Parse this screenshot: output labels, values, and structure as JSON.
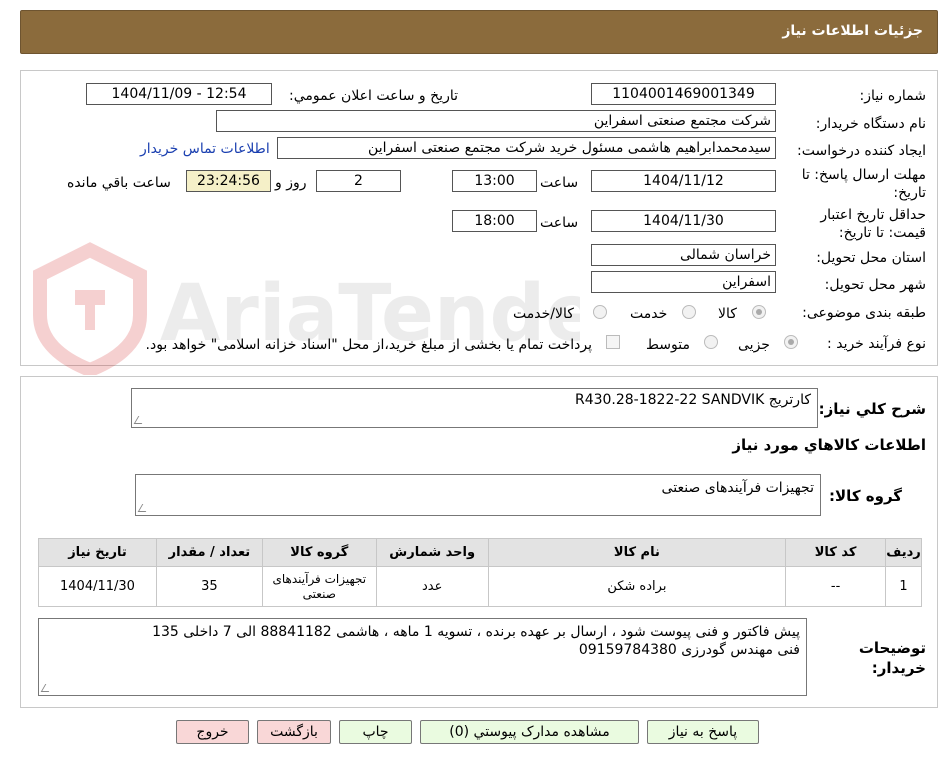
{
  "header": {
    "title": "جزئیات اطلاعات نیاز"
  },
  "form": {
    "need_number_label": "شماره نیاز:",
    "need_number": "1104001469001349",
    "announce_label": "تاریخ و ساعت اعلان عمومي:",
    "announce_value": "1404/11/09 - 12:54",
    "buyer_org_label": "نام دستگاه خريدار:",
    "buyer_org": "شرکت مجتمع صنعتی اسفراین",
    "creator_label": "ايجاد کننده درخواست:",
    "creator": "سیدمحمدابراهیم هاشمی مسئول خرید شرکت مجتمع صنعتی اسفراین",
    "contact_link": "اطلاعات تماس خریدار",
    "deadline_label": "مهلت ارسال پاسخ: تا تاریخ:",
    "deadline_date": "1404/11/12",
    "time_label": "ساعت",
    "deadline_time": "13:00",
    "days": "2",
    "days_label": "روز و",
    "remaining": "23:24:56",
    "remaining_label": "ساعت باقي مانده",
    "validity_label": "حداقل تاريخ اعتبار قيمت: تا تاريخ:",
    "validity_date": "1404/11/30",
    "validity_time": "18:00",
    "province_label": "استان محل تحويل:",
    "province": "خراسان شمالی",
    "city_label": "شهر محل تحويل:",
    "city": "اسفراین",
    "category_label": "طبقه بندی موضوعی:",
    "category_options": [
      "کالا",
      "خدمت",
      "کالا/خدمت"
    ],
    "category_selected": "کالا",
    "process_label": "نوع فرآيند خريد :",
    "process_options": [
      "جزیی",
      "متوسط"
    ],
    "process_note": "پرداخت تمام يا بخشی از مبلغ خريد،از محل \"اسناد خزانه اسلامی\" خواهد بود."
  },
  "watermark": {
    "text": "AriaTender.neT"
  },
  "summary": {
    "label": "شرح كلي نياز:",
    "value": "کارتریج R430.28-1822-22 SANDVIK",
    "goods_info_title": "اطلاعات كالاهاي مورد نياز",
    "group_label": "گروه کالا:",
    "group_value": "تجهیزات فرآیندهای صنعتی"
  },
  "table": {
    "headers": [
      "رديف",
      "کد کالا",
      "نام کالا",
      "واحد شمارش",
      "گروه کالا",
      "تعداد / مقدار",
      "تاريخ نياز"
    ],
    "rows": [
      [
        "1",
        "--",
        "براده شکن",
        "عدد",
        "تجهیزات فرآیندهای صنعتی",
        "35",
        "1404/11/30"
      ]
    ]
  },
  "notes": {
    "label": "توضيحات خريدار:",
    "line1": "پیش فاکتور و فنی پیوست شود ، ارسال بر عهده برنده ، تسویه 1 ماهه ، هاشمی 88841182 الی 7 داخلی 135",
    "line2": "فنی مهندس گودرزی 09159784380"
  },
  "buttons": {
    "reply": "پاسخ به نياز",
    "attachments": "مشاهده مدارک پيوستي (0)",
    "print": "چاپ",
    "back": "بازگشت",
    "exit": "خروج"
  }
}
